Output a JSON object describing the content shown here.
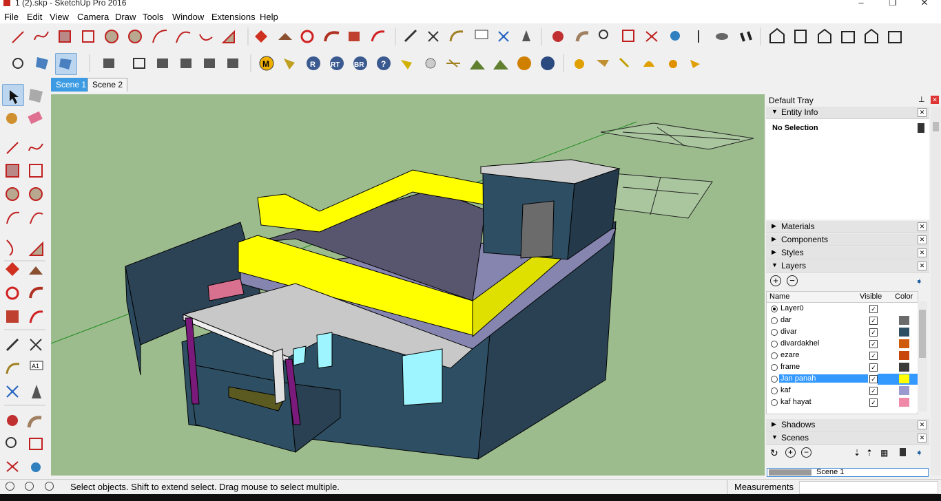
{
  "window": {
    "title": "1 (2).skp - SketchUp Pro 2016",
    "minimize": "–",
    "maximize": "❐",
    "close": "✕"
  },
  "menu": [
    "File",
    "Edit",
    "View",
    "Camera",
    "Draw",
    "Tools",
    "Window",
    "Extensions",
    "Help"
  ],
  "scenes": {
    "tabs": [
      "Scene 1",
      "Scene 2"
    ],
    "active": 0
  },
  "toolbar_text": {
    "a1_label": "A1",
    "m": "M",
    "r": "R",
    "rt": "RT",
    "br": "BR",
    "q": "?"
  },
  "tray": {
    "title": "Default Tray",
    "entity_info": {
      "title": "Entity Info",
      "selection": "No Selection"
    },
    "panels": [
      "Materials",
      "Components",
      "Styles"
    ],
    "layers": {
      "title": "Layers",
      "columns": {
        "name": "Name",
        "visible": "Visible",
        "color": "Color"
      },
      "rows": [
        {
          "name": "Layer0",
          "active": true,
          "color": ""
        },
        {
          "name": "dar",
          "active": false,
          "color": "#6b6b6b"
        },
        {
          "name": "divar",
          "active": false,
          "color": "#2e4f63"
        },
        {
          "name": "divardakhel",
          "active": false,
          "color": "#d05a0c"
        },
        {
          "name": "ezare",
          "active": false,
          "color": "#c9460a"
        },
        {
          "name": "frame",
          "active": false,
          "color": "#3a3a3a"
        },
        {
          "name": "Jan panah",
          "active": false,
          "color": "#ffff00",
          "selected": true
        },
        {
          "name": "kaf",
          "active": false,
          "color": "#9a9ad0"
        },
        {
          "name": "kaf hayat",
          "active": false,
          "color": "#f088a8"
        }
      ]
    },
    "shadows": {
      "title": "Shadows"
    },
    "scenes_panel": {
      "title": "Scenes",
      "scene_item": "Scene 1"
    }
  },
  "status": {
    "hint": "Select objects. Shift to extend select. Drag mouse to select multiple.",
    "measurements_label": "Measurements"
  },
  "colors": {
    "viewport_bg": "#9cbc8e",
    "wall": "#2e4f63",
    "parapet": "#ffff00",
    "roof": "#58556e",
    "slab": "#c8c8c8",
    "selection": "#3399ff"
  }
}
